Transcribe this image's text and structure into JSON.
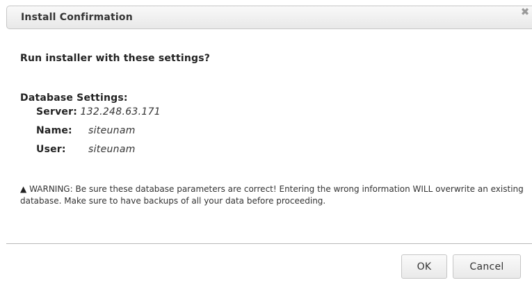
{
  "dialog": {
    "title": "Install Confirmation",
    "close_glyph": "✖",
    "question": "Run installer with these settings?",
    "db_heading": "Database Settings:",
    "settings": [
      {
        "label": "Server:",
        "value": "132.248.63.171"
      },
      {
        "label": "Name:",
        "value": "siteunam"
      },
      {
        "label": "User:",
        "value": "siteunam"
      }
    ],
    "warning": {
      "icon": "warning-triangle-icon",
      "icon_glyph": "▲",
      "text": "WARNING: Be sure these database parameters are correct! Entering the wrong information WILL overwrite an existing database. Make sure to have backups of all your data before proceeding."
    },
    "buttons": {
      "ok_label": "OK",
      "cancel_label": "Cancel"
    }
  }
}
